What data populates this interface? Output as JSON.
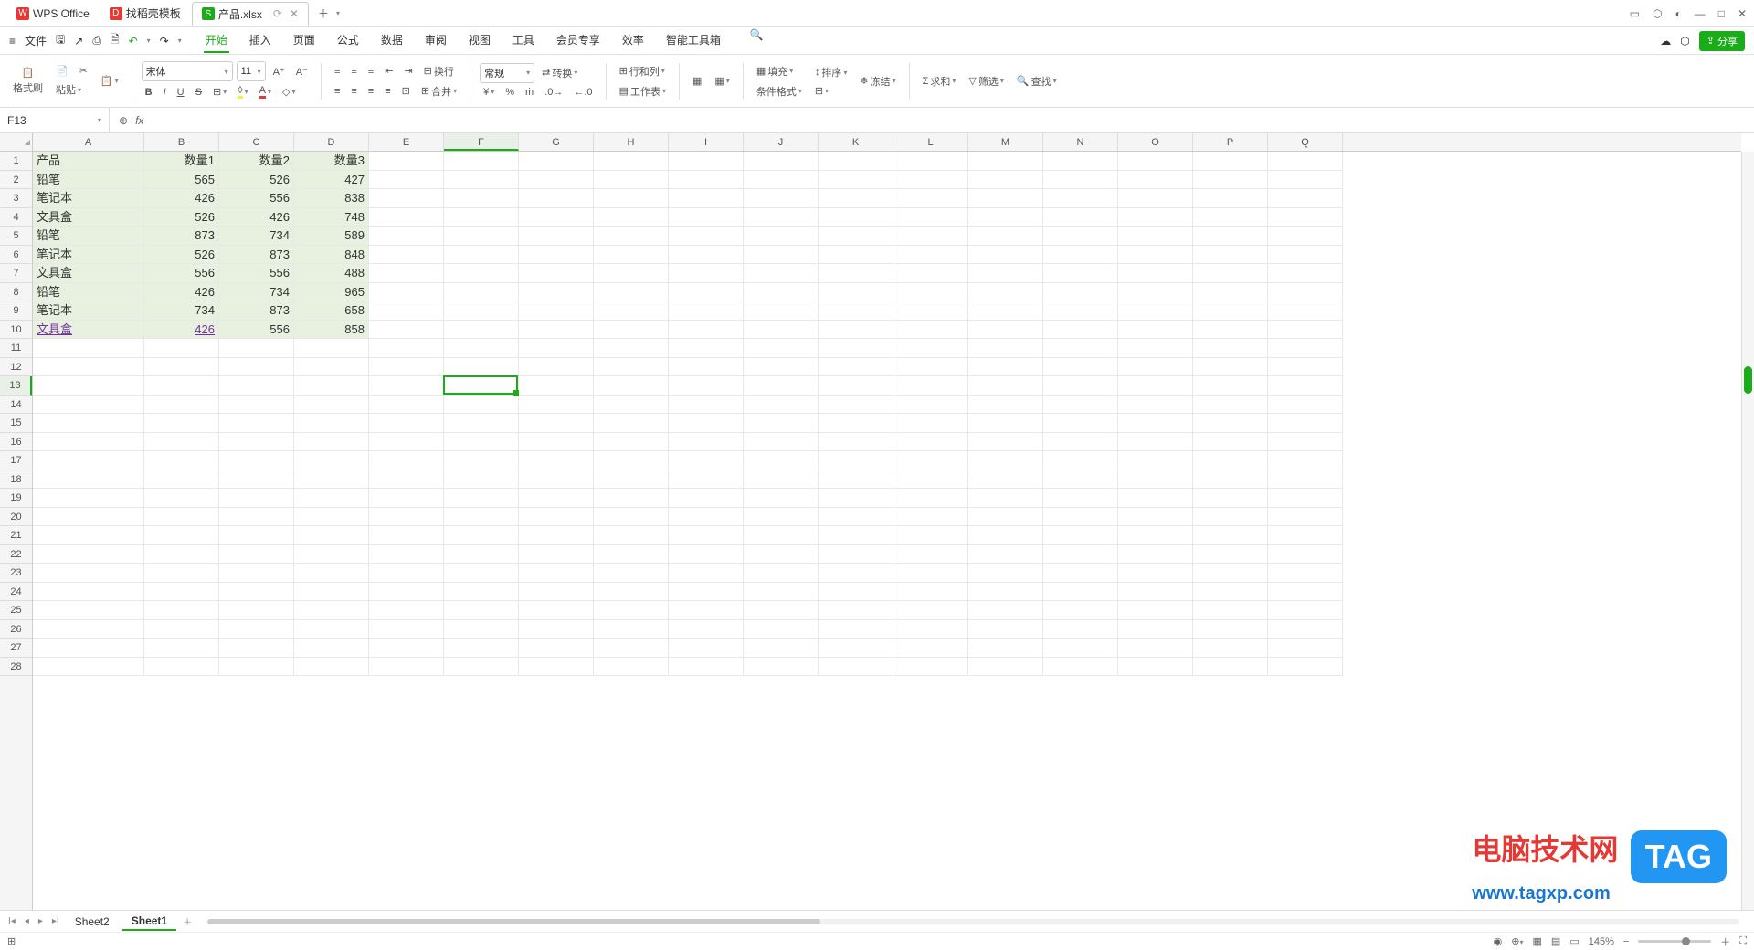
{
  "titlebar": {
    "app_name": "WPS Office",
    "template_tab": "找稻壳模板",
    "file_tab": "产品.xlsx",
    "file_tab_prefix": "S"
  },
  "menubar": {
    "file_label": "文件",
    "tabs": [
      "开始",
      "插入",
      "页面",
      "公式",
      "数据",
      "审阅",
      "视图",
      "工具",
      "会员专享",
      "效率",
      "智能工具箱"
    ],
    "share_label": "分享"
  },
  "ribbon": {
    "format_brush": "格式刷",
    "paste": "粘贴",
    "font_name": "宋体",
    "font_size": "11",
    "bold": "B",
    "italic": "I",
    "underline": "U",
    "strike": "S",
    "wrap": "换行",
    "merge": "合并",
    "number_format": "常规",
    "convert": "转换",
    "row_col": "行和列",
    "worksheet": "工作表",
    "cond_fmt": "条件格式",
    "fill": "填充",
    "sort": "排序",
    "freeze": "冻结",
    "sum": "求和",
    "filter": "筛选",
    "find": "查找"
  },
  "formula_bar": {
    "cell_ref": "F13",
    "fx": "fx"
  },
  "grid": {
    "cols": [
      "A",
      "B",
      "C",
      "D",
      "E",
      "F",
      "G",
      "H",
      "I",
      "J",
      "K",
      "L",
      "M",
      "N",
      "O",
      "P",
      "Q"
    ],
    "row_count": 28,
    "selected_cell": "F13",
    "headers": [
      "产品",
      "数量1",
      "数量2",
      "数量3"
    ],
    "data": [
      [
        "铅笔",
        "565",
        "526",
        "427"
      ],
      [
        "笔记本",
        "426",
        "556",
        "838"
      ],
      [
        "文具盒",
        "526",
        "426",
        "748"
      ],
      [
        "铅笔",
        "873",
        "734",
        "589"
      ],
      [
        "笔记本",
        "526",
        "873",
        "848"
      ],
      [
        "文具盒",
        "556",
        "556",
        "488"
      ],
      [
        "铅笔",
        "426",
        "734",
        "965"
      ],
      [
        "笔记本",
        "734",
        "873",
        "658"
      ],
      [
        "文具盒",
        "426",
        "556",
        "858"
      ]
    ]
  },
  "sheets": {
    "tabs": [
      "Sheet2",
      "Sheet1"
    ],
    "active": "Sheet1"
  },
  "status": {
    "zoom": "145%"
  },
  "watermark": {
    "title": "电脑技术网",
    "url": "www.tagxp.com",
    "tag": "TAG"
  }
}
